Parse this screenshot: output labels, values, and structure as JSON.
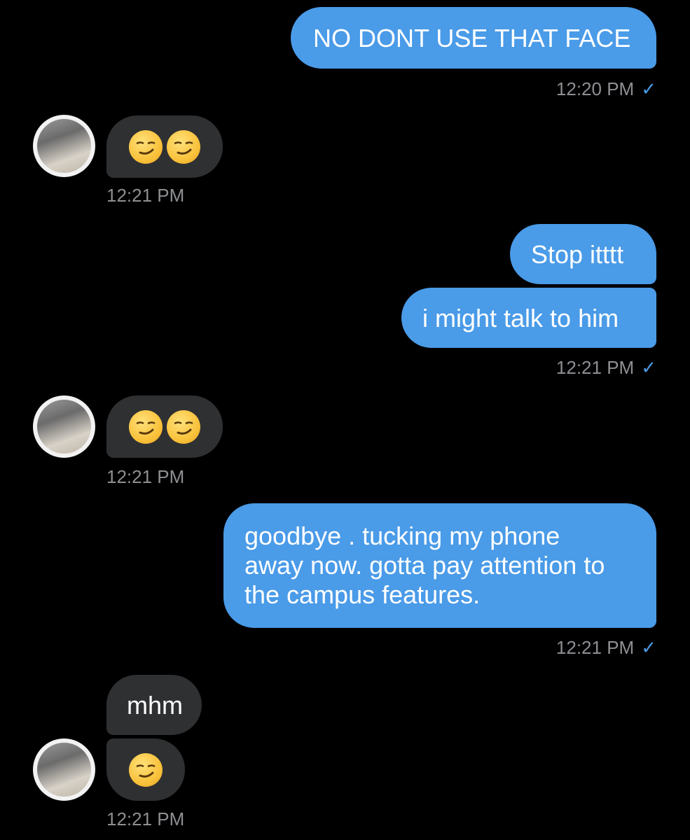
{
  "messages": {
    "m1": {
      "text": "NO DONT USE THAT FACE",
      "time": "12:20 PM",
      "read_mark": "✓"
    },
    "m2": {
      "emoji": [
        "smirking-face",
        "smirking-face"
      ],
      "time": "12:21 PM"
    },
    "m3": {
      "text": "Stop itttt"
    },
    "m4": {
      "text": "i might talk to him",
      "time": "12:21 PM",
      "read_mark": "✓"
    },
    "m5": {
      "emoji": [
        "smirking-face",
        "smirking-face"
      ],
      "time": "12:21 PM"
    },
    "m6": {
      "lines": [
        "goodbye . tucking my phone",
        "away now. gotta pay attention to",
        "the campus features."
      ],
      "time": "12:21 PM",
      "read_mark": "✓"
    },
    "m7": {
      "text": "mhm"
    },
    "m8": {
      "emoji": [
        "smirking-face"
      ],
      "time": "12:21 PM"
    }
  },
  "colors": {
    "background": "#000000",
    "outgoing_bubble": "#4a9be8",
    "incoming_bubble": "#2f3032",
    "timestamp": "#8e8f93",
    "read_check": "#4a9be8"
  },
  "icons": {
    "avatar": "contact-avatar",
    "emoji": "smirking-face-emoji",
    "read_receipt": "check-icon"
  }
}
